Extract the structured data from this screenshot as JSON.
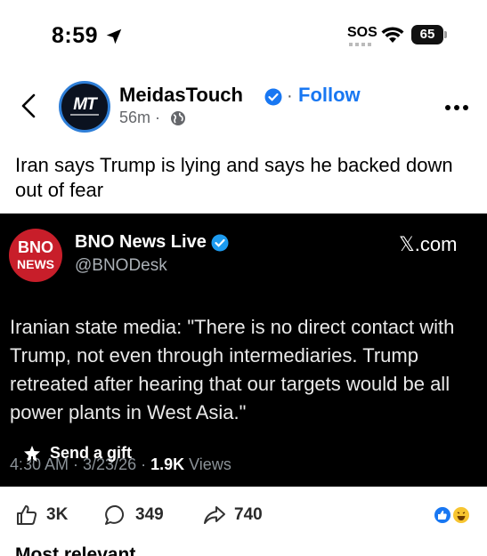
{
  "status_bar": {
    "time": "8:59",
    "sos": "SOS",
    "battery": "65"
  },
  "post": {
    "author": "MeidasTouch",
    "avatar_text": "MT",
    "follow_label": "Follow",
    "time_ago": "56m",
    "text": "Iran says Trump is lying and says he backed down out of fear"
  },
  "embed": {
    "logo_top": "BNO",
    "logo_bottom": "NEWS",
    "author": "BNO News Live",
    "handle": "@BNODesk",
    "source": "𝕏.com",
    "body": "Iranian state media: \"There is no direct contact with Trump, not even through intermediaries. Trump retreated after hearing that our targets would be all power plants in West Asia.\"",
    "meta_prefix": "4:30 AM · 3/23/26 · ",
    "views_count": "1.9K",
    "views_label": " Views",
    "gift_label": "Send a gift"
  },
  "actions": {
    "like_count": "3K",
    "comment_count": "349",
    "share_count": "740"
  },
  "comments_header": "Most relevant",
  "colors": {
    "accent": "#1877f2",
    "bno_red": "#c81e2a",
    "card_bg": "#000000"
  }
}
